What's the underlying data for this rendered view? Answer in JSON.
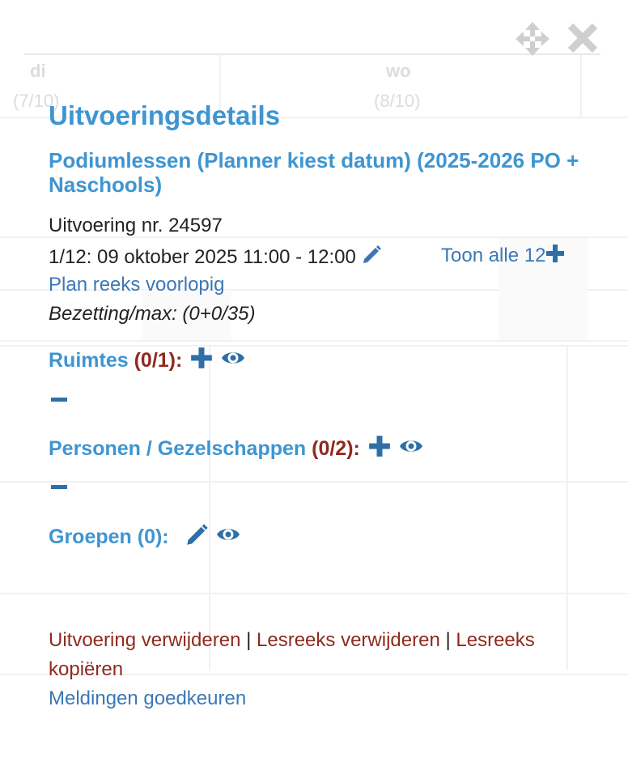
{
  "calendar": {
    "days": [
      {
        "name": "di",
        "date": "(7/10)"
      },
      {
        "name": "wo",
        "date": "(8/10)"
      }
    ]
  },
  "dialog": {
    "controls": {
      "move_icon": "move-arrows-icon",
      "close_icon": "close-x-icon"
    },
    "title": "Uitvoeringsdetails",
    "subtitle": "Podiumlessen (Planner kiest datum) (2025-2026 PO + Naschools)",
    "performance_number": "Uitvoering nr. 24597",
    "datetime": "1/12: 09 oktober 2025 11:00 - 12:00",
    "show_all": "Toon alle 12",
    "plan_series": "Plan reeks voorlopig",
    "occupancy": "Bezetting/max: (0+0/35)",
    "sections": {
      "rooms": {
        "label": "Ruimtes",
        "count": "(0/1)",
        "colon": ":"
      },
      "persons": {
        "label": "Personen / Gezelschappen",
        "count": "(0/2)",
        "colon": ":"
      },
      "groups": {
        "label": "Groepen (0)",
        "colon": ":"
      }
    },
    "footer": {
      "delete_performance": "Uitvoering verwijderen",
      "delete_series": "Lesreeks verwijderen",
      "copy_series": "Lesreeks kopiëren",
      "separator": "|",
      "approve_notifications": "Meldingen goedkeuren"
    }
  },
  "colors": {
    "heading_blue": "#3e95d1",
    "link_blue": "#3a78b5",
    "icon_blue": "#2f6ea7",
    "danger_red": "#8f2a1f",
    "control_gray": "#cfcfcf"
  }
}
